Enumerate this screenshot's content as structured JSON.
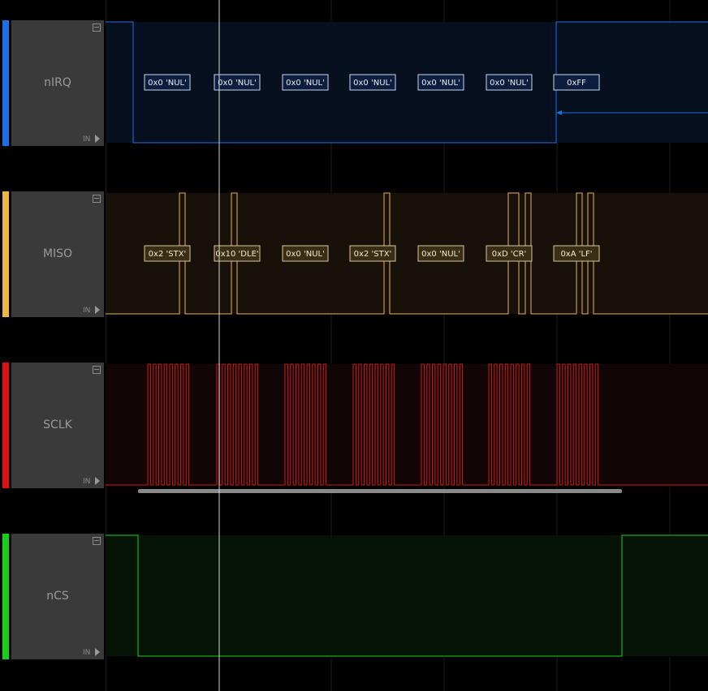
{
  "channels": [
    {
      "name": "nIRQ",
      "color": "#1a6fe6",
      "io": "IN",
      "decoded": [
        "0x0 'NUL'",
        "0x0 'NUL'",
        "0x0 'NUL'",
        "0x0 'NUL'",
        "0x0 'NUL'",
        "0x0 'NUL'",
        "0xFF"
      ]
    },
    {
      "name": "MISO",
      "color": "#f0b53c",
      "io": "IN",
      "decoded": [
        "0x2 'STX'",
        "0x10 'DLE'",
        "0x0 'NUL'",
        "0x2 'STX'",
        "0x0 'NUL'",
        "0xD 'CR'",
        "0xA 'LF'"
      ]
    },
    {
      "name": "SCLK",
      "color": "#e01010",
      "io": "IN",
      "decoded": []
    },
    {
      "name": "nCS",
      "color": "#16d016",
      "io": "IN",
      "decoded": []
    }
  ]
}
